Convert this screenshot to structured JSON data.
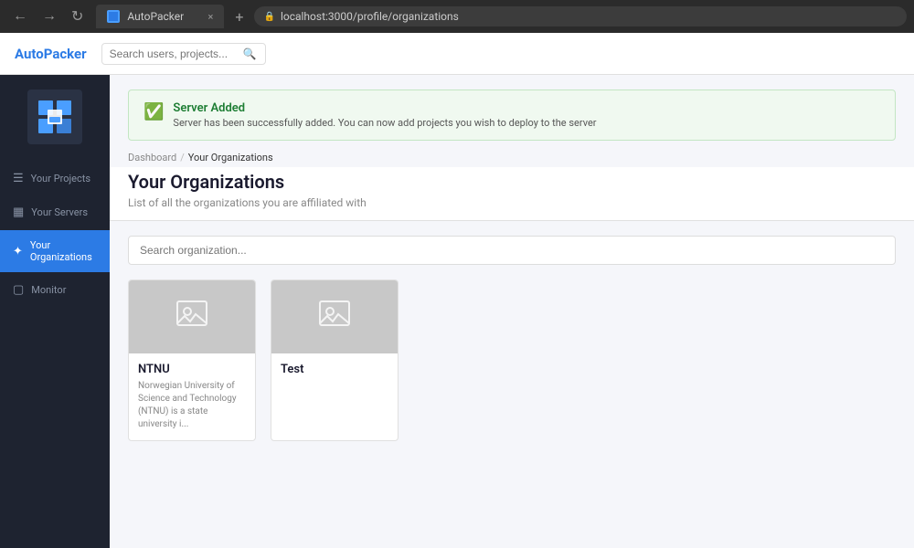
{
  "browser": {
    "tab_title": "AutoPacker",
    "address": "localhost:3000/profile/organizations",
    "tab_close": "×",
    "tab_add": "+"
  },
  "header": {
    "logo": "AutoPacker",
    "search_placeholder": "Search users, projects..."
  },
  "sidebar": {
    "items": [
      {
        "id": "projects",
        "label": "Your Projects",
        "icon": "☰"
      },
      {
        "id": "servers",
        "label": "Your Servers",
        "icon": "▦"
      },
      {
        "id": "organizations",
        "label": "Your Organizations",
        "icon": "✦",
        "active": true
      },
      {
        "id": "monitor",
        "label": "Monitor",
        "icon": "□"
      }
    ]
  },
  "success_banner": {
    "title": "Server Added",
    "message": "Server has been successfully added. You can now add projects you wish to deploy to the server"
  },
  "breadcrumb": {
    "parent": "Dashboard",
    "separator": "/",
    "current": "Your Organizations"
  },
  "page": {
    "title": "Your Organizations",
    "subtitle": "List of all the organizations you are affiliated with"
  },
  "search": {
    "placeholder": "Search organization..."
  },
  "organizations": [
    {
      "id": "ntnu",
      "name": "NTNU",
      "description": "Norwegian University of Science and Technology (NTNU) is a state university i..."
    },
    {
      "id": "test",
      "name": "Test",
      "description": ""
    }
  ]
}
